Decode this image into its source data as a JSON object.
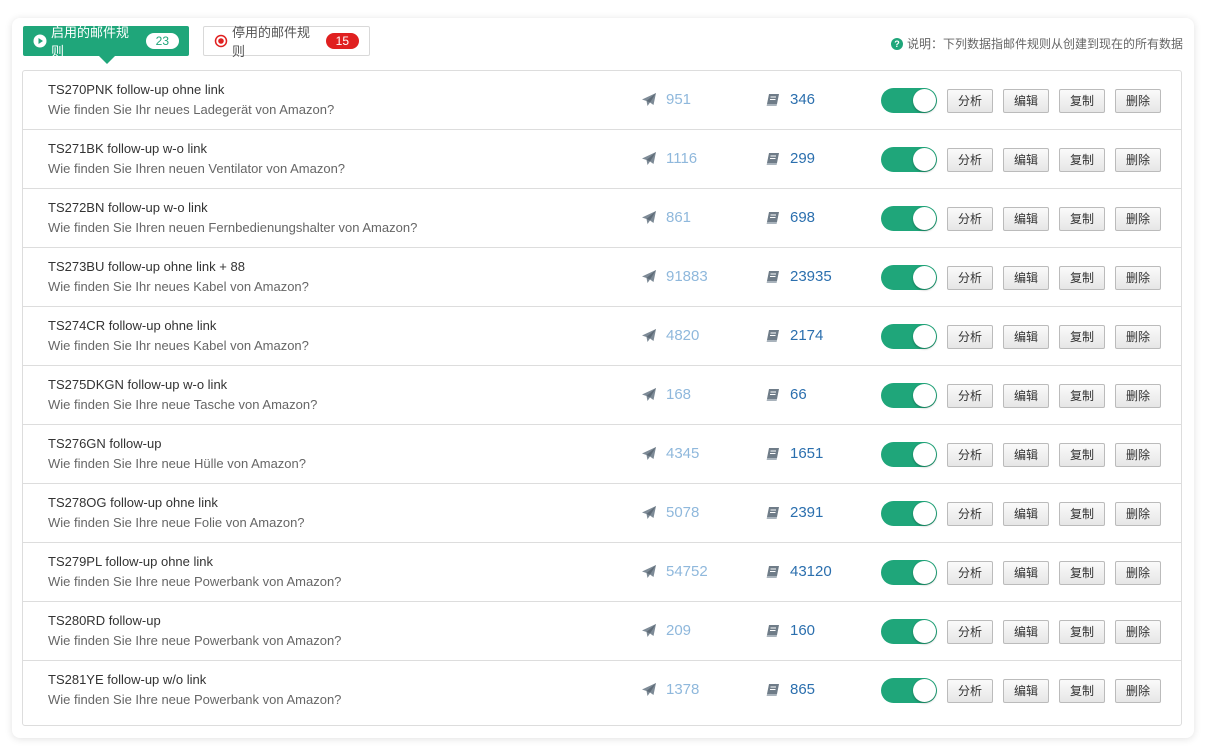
{
  "tabs": {
    "active": {
      "label": "启用的邮件规则",
      "count": "23"
    },
    "inactive": {
      "label": "停用的邮件规则",
      "count": "15"
    }
  },
  "note": "说明：下列数据指邮件规则从创建到现在的所有数据",
  "colors": {
    "accent": "#1fa67a",
    "red_badge": "#e02020",
    "sent_num": "#8fb8dc",
    "read_num": "#2b6fae"
  },
  "buttons": {
    "analyze": "分析",
    "edit": "编辑",
    "copy": "复制",
    "delete": "删除"
  },
  "rules": [
    {
      "title": "TS270PNK follow-up ohne link",
      "subject": "Wie finden Sie Ihr neues Ladegerät von Amazon?",
      "sent": "951",
      "read": "346",
      "enabled": true
    },
    {
      "title": "TS271BK follow-up w-o link",
      "subject": "Wie finden Sie Ihren neuen Ventilator von Amazon?",
      "sent": "1116",
      "read": "299",
      "enabled": true
    },
    {
      "title": "TS272BN follow-up w-o link",
      "subject": "Wie finden Sie Ihren neuen Fernbedienungshalter von Amazon?",
      "sent": "861",
      "read": "698",
      "enabled": true
    },
    {
      "title": "TS273BU follow-up ohne link + 88",
      "subject": "Wie finden Sie Ihr neues Kabel von Amazon?",
      "sent": "91883",
      "read": "23935",
      "enabled": true
    },
    {
      "title": "TS274CR follow-up ohne link",
      "subject": "Wie finden Sie Ihr neues Kabel von Amazon?",
      "sent": "4820",
      "read": "2174",
      "enabled": true
    },
    {
      "title": "TS275DKGN follow-up w-o link",
      "subject": "Wie finden Sie Ihre neue Tasche von Amazon?",
      "sent": "168",
      "read": "66",
      "enabled": true
    },
    {
      "title": "TS276GN follow-up",
      "subject": "Wie finden Sie Ihre neue Hülle von Amazon?",
      "sent": "4345",
      "read": "1651",
      "enabled": true
    },
    {
      "title": "TS278OG follow-up ohne link",
      "subject": "Wie finden Sie Ihre neue Folie von Amazon?",
      "sent": "5078",
      "read": "2391",
      "enabled": true
    },
    {
      "title": "TS279PL follow-up ohne link",
      "subject": "Wie finden Sie Ihre neue Powerbank von Amazon?",
      "sent": "54752",
      "read": "43120",
      "enabled": true
    },
    {
      "title": "TS280RD follow-up",
      "subject": "Wie finden Sie Ihre neue Powerbank von Amazon?",
      "sent": "209",
      "read": "160",
      "enabled": true
    },
    {
      "title": "TS281YE follow-up w/o link",
      "subject": "Wie finden Sie Ihre neue Powerbank von Amazon?",
      "sent": "1378",
      "read": "865",
      "enabled": true
    }
  ]
}
